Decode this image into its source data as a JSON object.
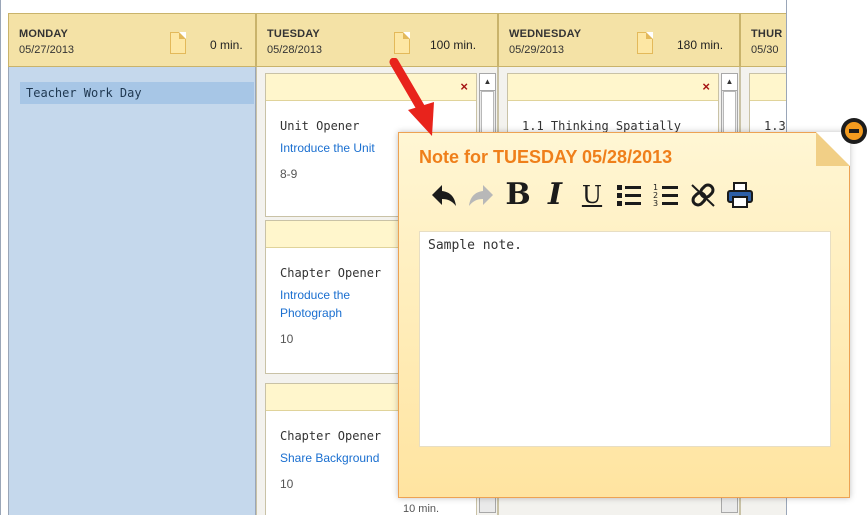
{
  "days": [
    {
      "name": "MONDAY",
      "date": "05/27/2013",
      "minutes": "0 min."
    },
    {
      "name": "TUESDAY",
      "date": "05/28/2013",
      "minutes": "100 min."
    },
    {
      "name": "WEDNESDAY",
      "date": "05/29/2013",
      "minutes": "180 min."
    },
    {
      "name": "THUR",
      "date": "05/30"
    }
  ],
  "monday_event": "Teacher Work Day",
  "tuesday_cards": [
    {
      "title": "Unit Opener",
      "link": "Introduce the Unit",
      "pages": "8-9"
    },
    {
      "title": "Chapter Opener",
      "link": "Introduce the Photograph",
      "pages": "10"
    },
    {
      "title": "Chapter Opener",
      "link": "Share Background",
      "pages": "10"
    }
  ],
  "tuesday_partial_duration": "10 min.",
  "wednesday_cards": [
    {
      "title": "1.1  Thinking Spatially"
    }
  ],
  "thursday_partial": "1.3",
  "remove_glyph": "×",
  "popup": {
    "title": "Note for TUESDAY 05/28/2013",
    "toolbar": {
      "bold": "B",
      "italic": "I",
      "underline": "U"
    },
    "note_text": "Sample note."
  },
  "colors": {
    "header_bg": "#f4e2a6",
    "monday_bg": "#c5d8ec",
    "popup_title": "#ef7f1a",
    "link": "#1a6fd0",
    "arrow": "#e8231c"
  },
  "icons": [
    "note-icon",
    "remove-icon",
    "undo-icon",
    "redo-icon",
    "bold-icon",
    "italic-icon",
    "underline-icon",
    "bullet-list-icon",
    "numbered-list-icon",
    "link-icon",
    "print-icon",
    "minimize-icon",
    "arrow-icon"
  ]
}
